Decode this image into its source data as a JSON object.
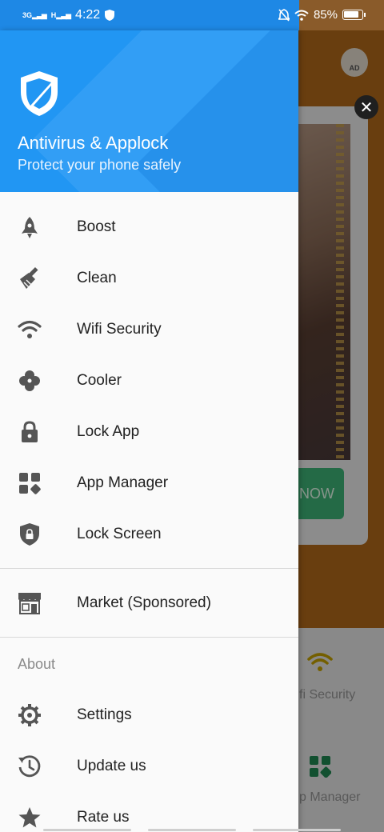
{
  "status_bar": {
    "network_1": "3G",
    "network_2": "H",
    "time": "4:22",
    "battery": "85%",
    "battery_level": 0.85
  },
  "drawer": {
    "title": "Antivirus & Applock",
    "subtitle": "Protect your phone safely",
    "items": [
      {
        "label": "Boost",
        "icon": "rocket-icon"
      },
      {
        "label": "Clean",
        "icon": "broom-icon"
      },
      {
        "label": "Wifi Security",
        "icon": "wifi-icon"
      },
      {
        "label": "Cooler",
        "icon": "fan-icon"
      },
      {
        "label": "Lock App",
        "icon": "lock-icon"
      },
      {
        "label": "App Manager",
        "icon": "apps-grid-icon"
      },
      {
        "label": "Lock Screen",
        "icon": "shield-lock-icon"
      }
    ],
    "market": {
      "label": "Market (Sponsored)",
      "icon": "store-icon"
    },
    "about_section": {
      "title": "About",
      "items": [
        {
          "label": "Settings",
          "icon": "gear-icon"
        },
        {
          "label": "Update us",
          "icon": "update-clock-icon"
        },
        {
          "label": "Rate us",
          "icon": "star-icon"
        }
      ]
    }
  },
  "background": {
    "ad_badge": "AD",
    "cta_text": "NOW",
    "bottom_label_1": "fi Security",
    "bottom_label_2": "p Manager"
  },
  "colors": {
    "header_blue": "#2196f3",
    "icon_gray": "#555555",
    "bg_orange": "#b56b1a",
    "cta_green": "#3fb779"
  }
}
